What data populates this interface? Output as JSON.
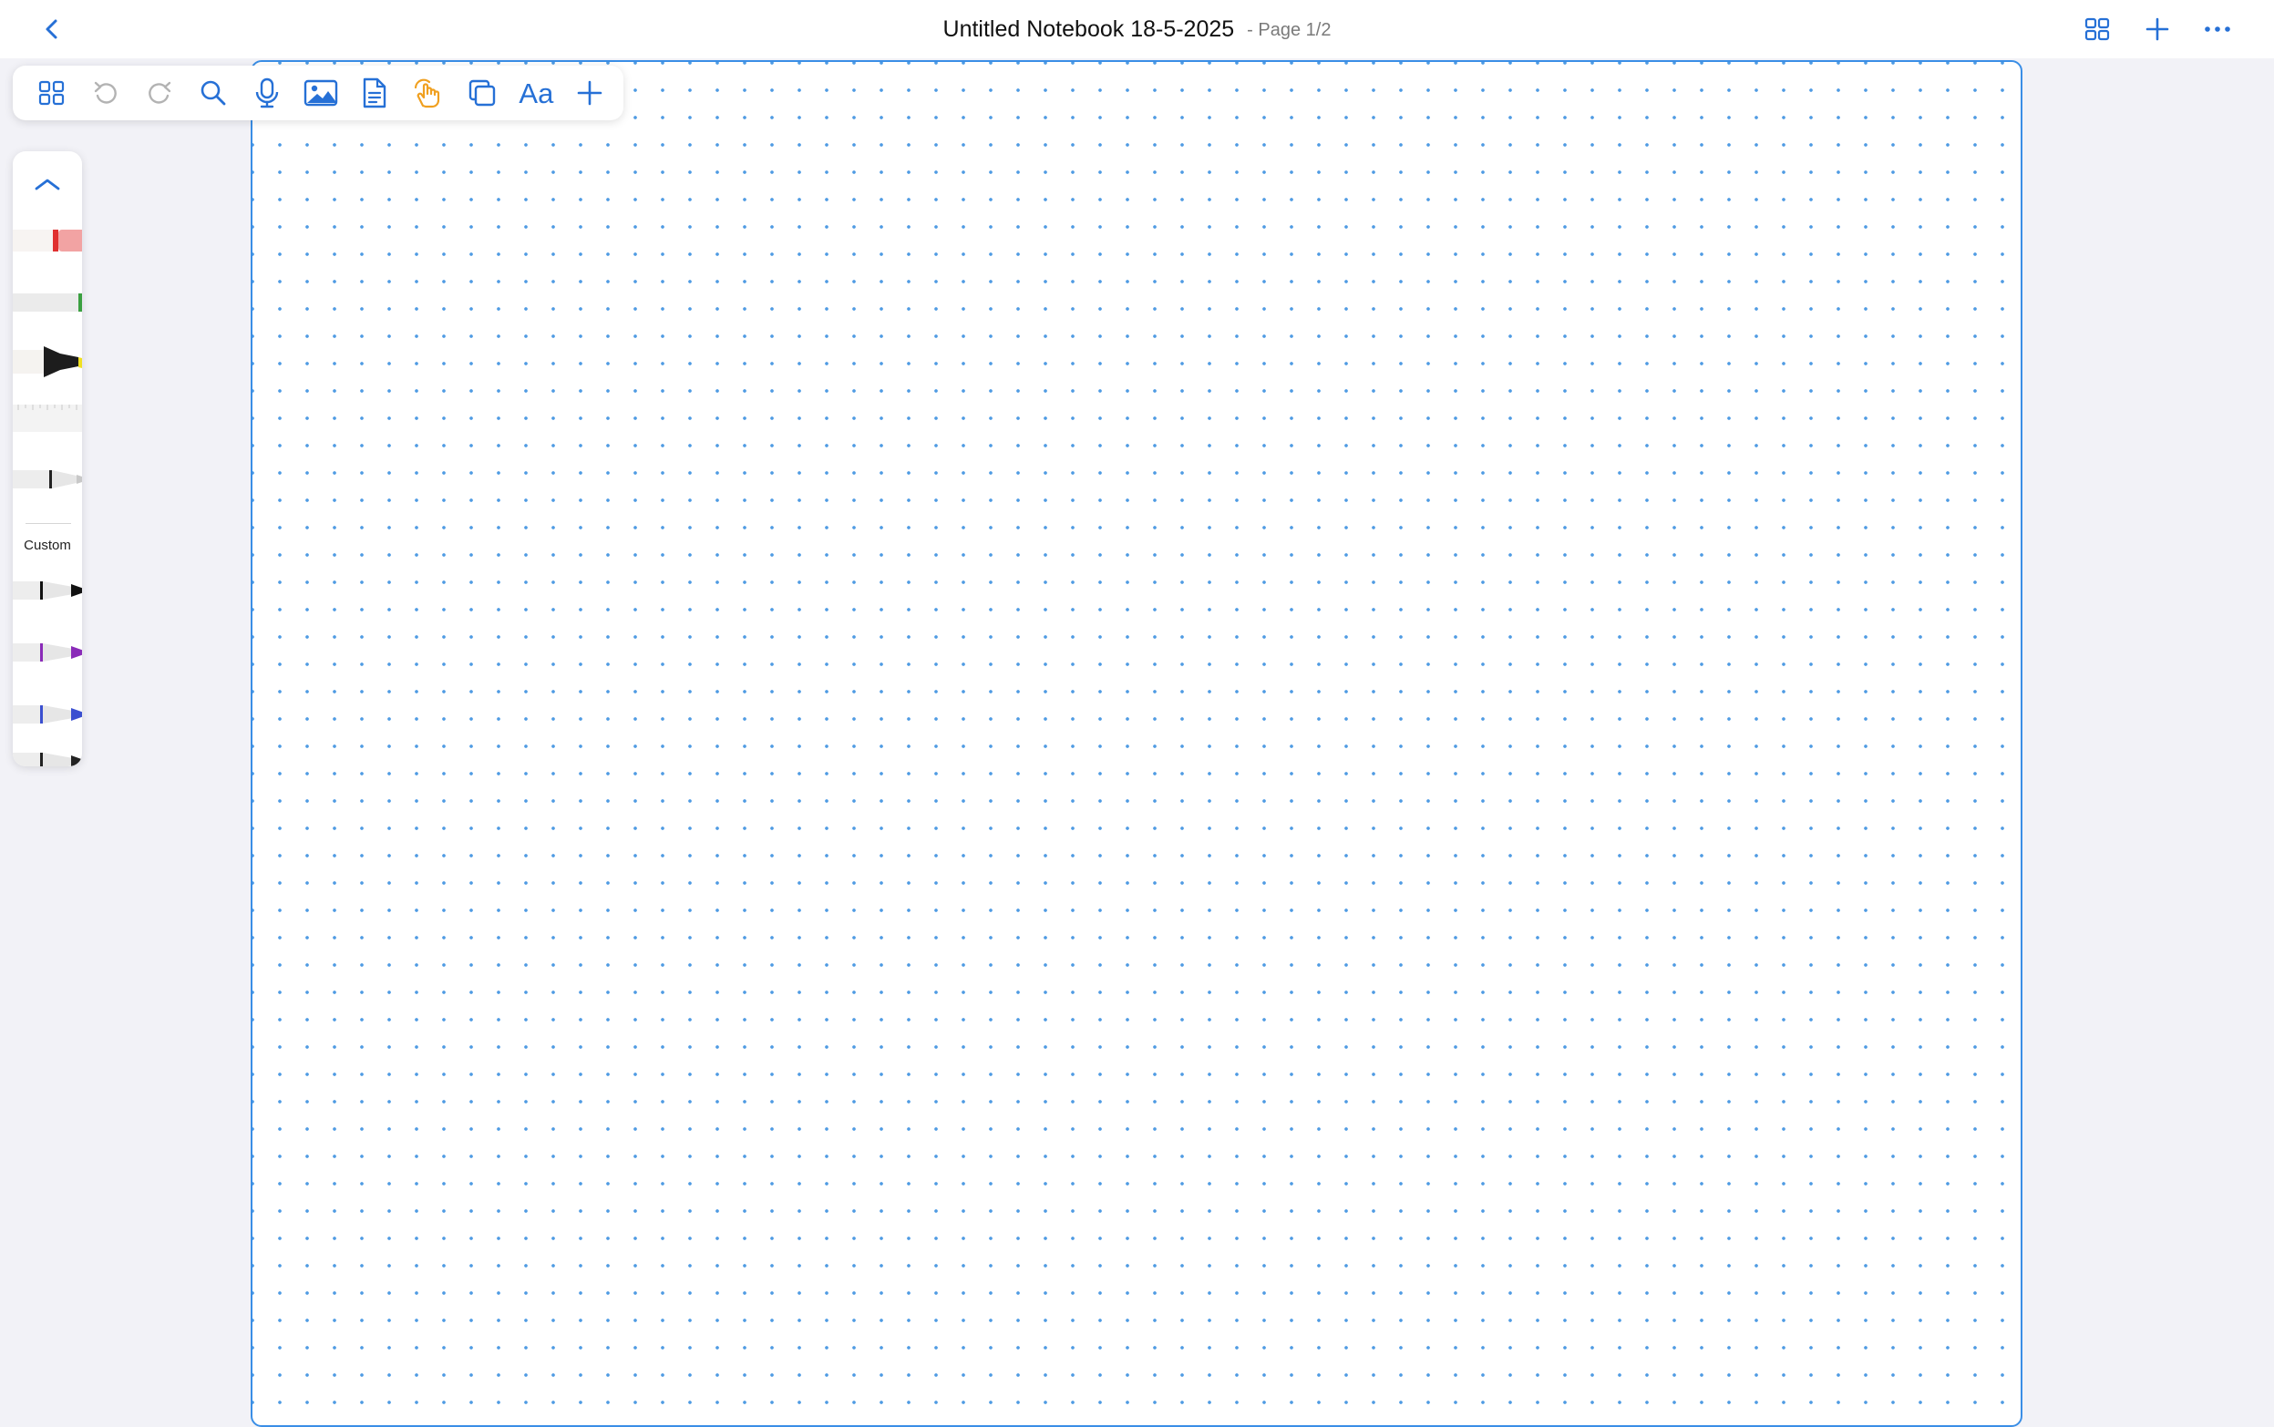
{
  "header": {
    "title": "Untitled Notebook 18-5-2025",
    "page_indicator": "- Page 1/2",
    "back_icon": "chevron-left-icon",
    "right_icons": [
      "grid-view-icon",
      "plus-icon",
      "more-icon"
    ]
  },
  "toolbar": {
    "icons": [
      "page-grid-icon",
      "undo-icon",
      "redo-icon",
      "search-icon",
      "microphone-icon",
      "image-icon",
      "document-icon",
      "hand-pointer-icon",
      "copy-icon",
      "text-icon",
      "add-icon"
    ],
    "text_tool_label": "Aa"
  },
  "sidebar": {
    "collapse_icon": "chevron-up-icon",
    "custom_label": "Custom",
    "tools": [
      "eraser",
      "pencil-green",
      "highlighter-yellow",
      "ruler",
      "fountain-pen",
      "pen-black",
      "pen-purple",
      "pen-blue",
      "pen-dark"
    ]
  },
  "canvas": {
    "paper": "dotted",
    "dot_color": "#4f9be3",
    "border_color": "#3a8ee6"
  },
  "colors": {
    "accent": "#2670d6",
    "hand_tool_active": "#f0a020",
    "background": "#f2f2f7"
  }
}
